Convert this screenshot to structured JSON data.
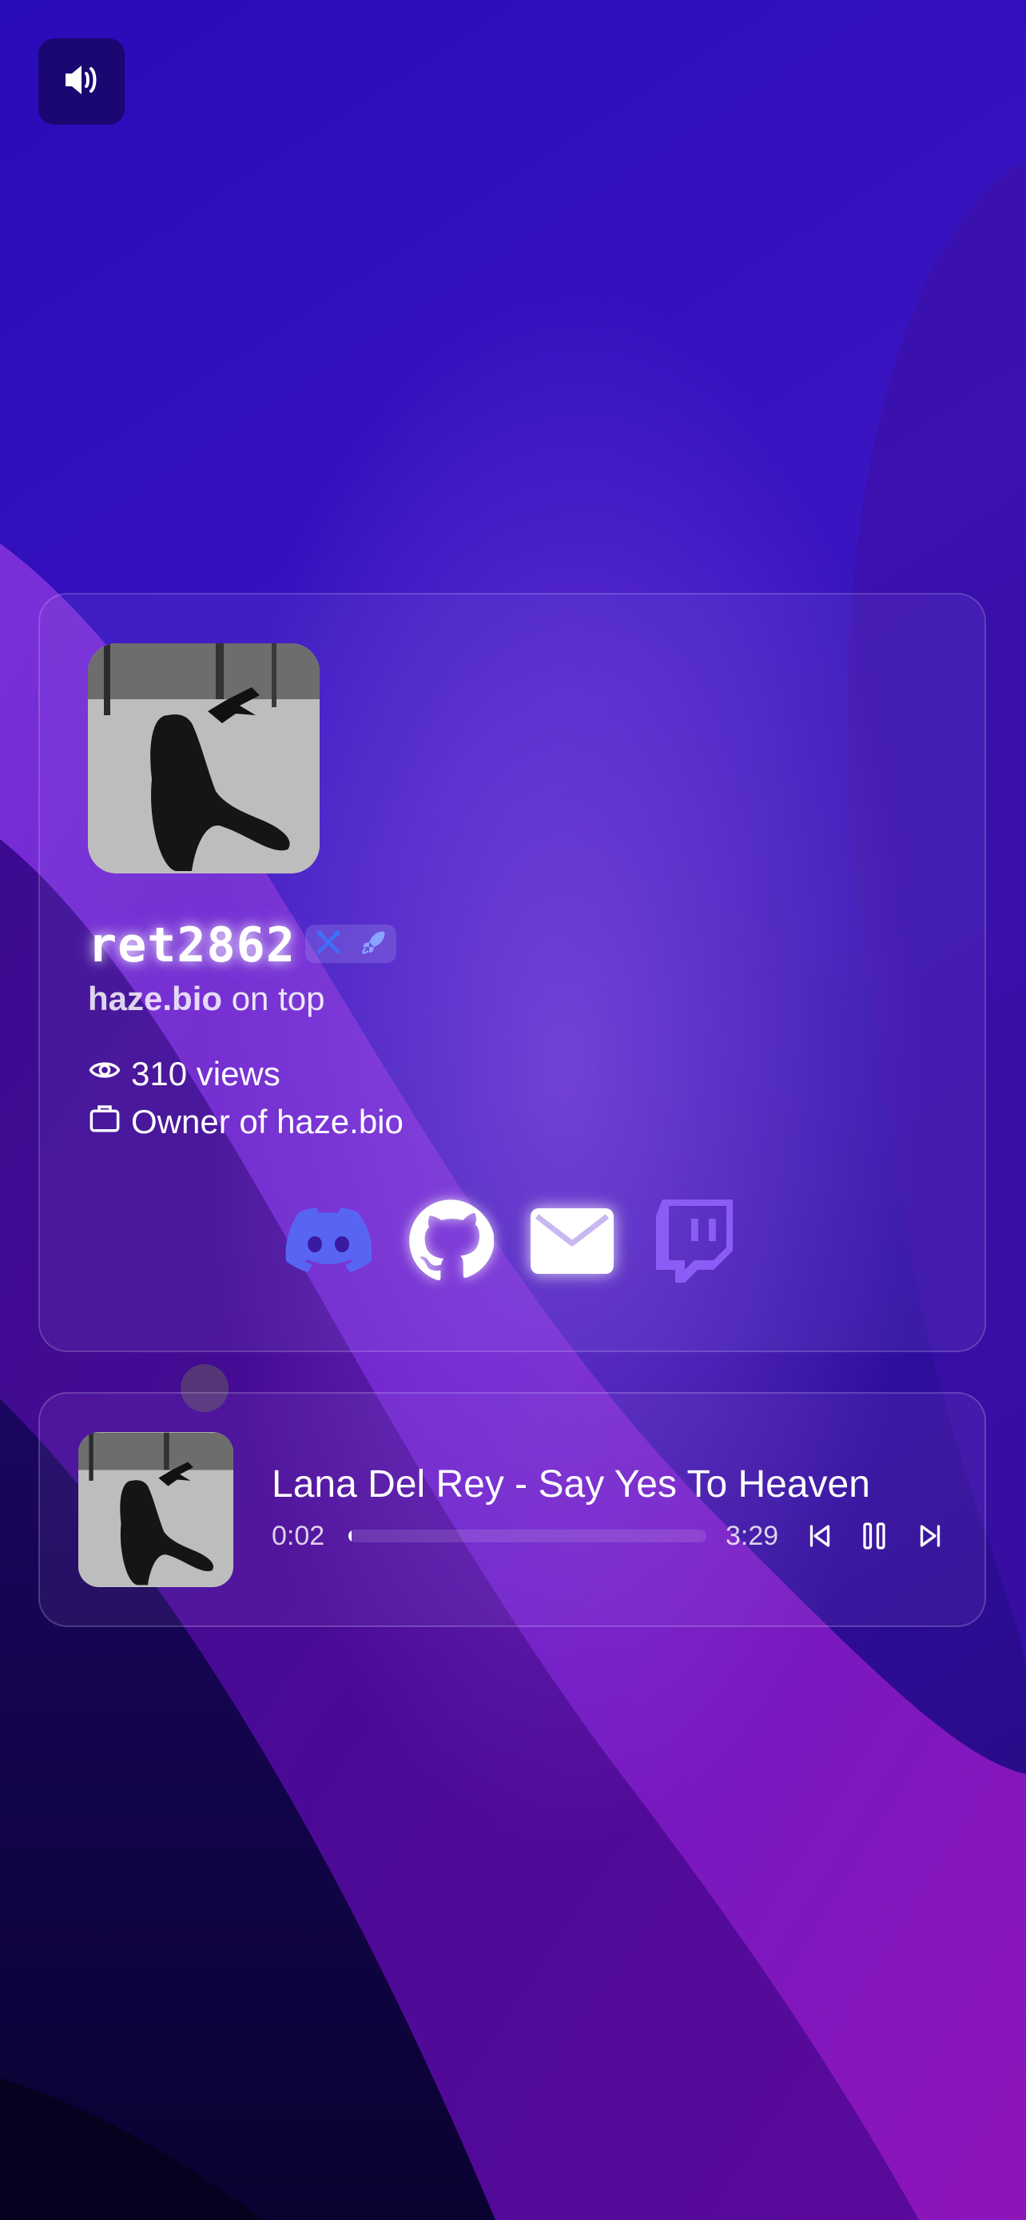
{
  "colors": {
    "background_top": "#2a0bb8",
    "background_bottom": "#0c0433",
    "accent_purple": "#7b2bd6",
    "discord": "#5865f2",
    "twitch": "#8b5cf6"
  },
  "header": {
    "sound_icon": "volume-icon"
  },
  "profile": {
    "username": "ret2862",
    "badges": [
      "tools-icon",
      "rocket-icon"
    ],
    "bio_strong": "haze.bio",
    "bio_rest": " on top",
    "views": "310 views",
    "role": "Owner of haze.bio",
    "socials": [
      "discord-icon",
      "github-icon",
      "email-icon",
      "twitch-icon"
    ]
  },
  "player": {
    "title": "Lana Del Rey - Say Yes To Heaven",
    "elapsed": "0:02",
    "duration": "3:29",
    "progress": 0.01,
    "controls": [
      "previous-icon",
      "pause-icon",
      "next-icon"
    ]
  }
}
